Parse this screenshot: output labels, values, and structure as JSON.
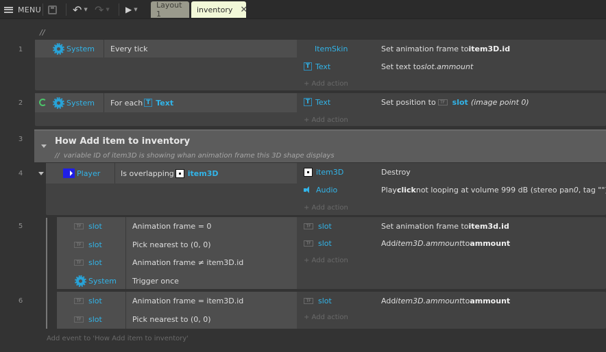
{
  "toolbar": {
    "menu_label": "MENU",
    "tabs": [
      {
        "label": "Layout 1"
      },
      {
        "label": "inventory",
        "close": "✕"
      }
    ],
    "undo_icon": "undo-icon",
    "redo_icon": "redo-icon",
    "play_icon": "play-icon"
  },
  "sheet": {
    "top_comment": "//",
    "line_numbers": [
      "1",
      "2",
      "3",
      "4",
      "5",
      "6"
    ],
    "events": {
      "e1": {
        "conditions": [
          {
            "object": "System",
            "text": "Every tick"
          }
        ],
        "actions": [
          {
            "object": "ItemSkin",
            "pre": "Set animation frame to ",
            "bold": "item3D.id"
          },
          {
            "object": "Text",
            "pre": "Set text to ",
            "italic": "slot.ammount"
          }
        ],
        "add_action": "+ Add action"
      },
      "e2": {
        "conditions": [
          {
            "object": "System",
            "pre": "For each ",
            "target": "Text"
          }
        ],
        "actions": [
          {
            "object": "Text",
            "pre": "Set position to ",
            "target": "slot",
            "italic": "(image point 0)"
          }
        ],
        "add_action": "+ Add action"
      },
      "group": {
        "title": "How Add item to inventory",
        "comment_prefix": "//",
        "description": "variable ID of item3D is showing whan animation frame this 3D shape displays"
      },
      "e4": {
        "conditions": [
          {
            "object": "Player",
            "pre": "Is overlapping ",
            "target": "item3D"
          }
        ],
        "actions": [
          {
            "object": "item3D",
            "text": "Destroy"
          },
          {
            "object": "Audio",
            "pre": "Play ",
            "bold": "click",
            "post": " not looping at volume 999 dB (stereo pan ",
            "italic": "0",
            "post2": ", tag \"\")"
          }
        ],
        "add_action": "+ Add action"
      },
      "e5": {
        "conditions": [
          {
            "object": "slot",
            "text": "Animation frame = 0"
          },
          {
            "object": "slot",
            "text": "Pick nearest to (0, 0)"
          },
          {
            "object": "slot",
            "text": "Animation frame ≠ item3D.id"
          },
          {
            "object": "System",
            "text": "Trigger once"
          }
        ],
        "actions": [
          {
            "object": "slot",
            "pre": "Set animation frame to ",
            "bold": "item3d.id"
          },
          {
            "object": "slot",
            "pre": "Add ",
            "italic": "item3D.ammount",
            "post": " to ",
            "bold": "ammount"
          }
        ],
        "add_action": "+ Add action"
      },
      "e6": {
        "conditions": [
          {
            "object": "slot",
            "text": "Animation frame = item3D.id"
          },
          {
            "object": "slot",
            "text": "Pick nearest to (0, 0)"
          }
        ],
        "actions": [
          {
            "object": "slot",
            "pre": "Add ",
            "italic": "item3D.ammount",
            "post": " to ",
            "bold": "ammount"
          }
        ],
        "add_action": "+ Add action"
      }
    },
    "add_event": "Add event to 'How Add item to inventory'"
  }
}
